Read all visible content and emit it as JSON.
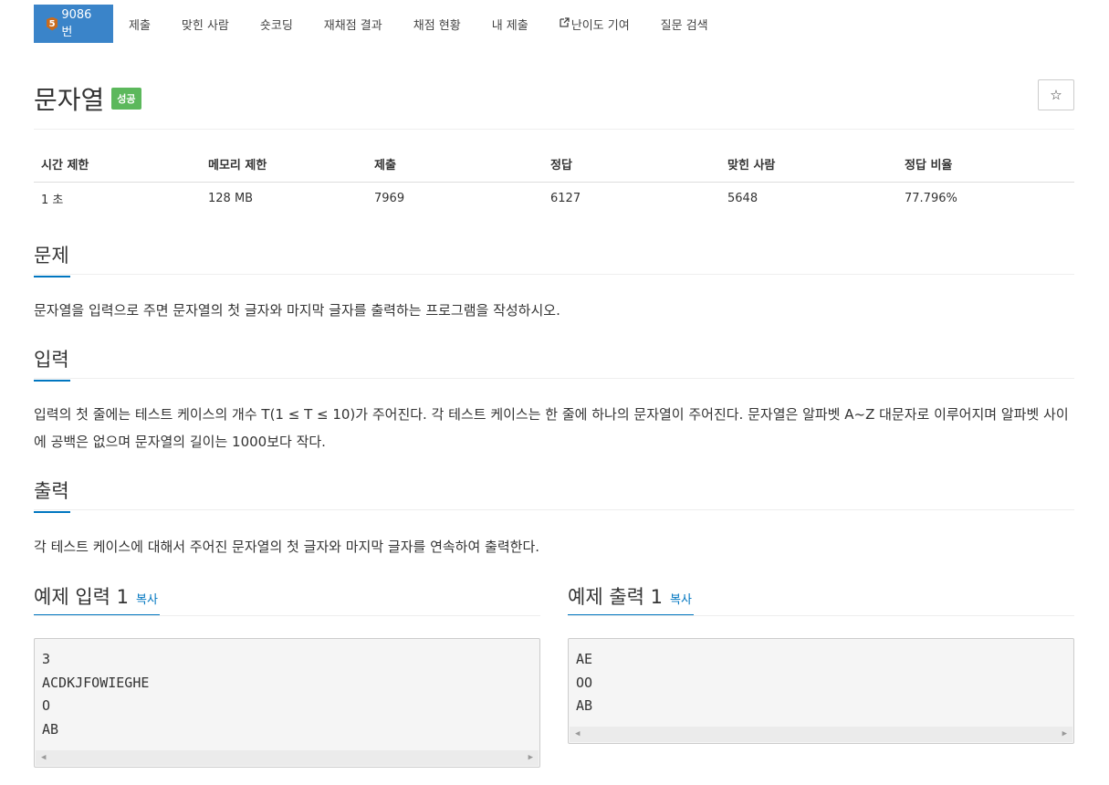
{
  "nav": {
    "tier": "5",
    "problem_number": "9086번",
    "items": [
      "제출",
      "맞힌 사람",
      "숏코딩",
      "재채점 결과",
      "채점 현황",
      "내 제출",
      "난이도 기여",
      "질문 검색"
    ]
  },
  "title": "문자열",
  "status_badge": "성공",
  "star_label": "☆",
  "info": {
    "headers": [
      "시간 제한",
      "메모리 제한",
      "제출",
      "정답",
      "맞힌 사람",
      "정답 비율"
    ],
    "values": [
      "1 초",
      "128 MB",
      "7969",
      "6127",
      "5648",
      "77.796%"
    ]
  },
  "sections": {
    "problem": {
      "heading": "문제",
      "text": "문자열을 입력으로 주면 문자열의 첫 글자와 마지막 글자를 출력하는 프로그램을 작성하시오."
    },
    "input": {
      "heading": "입력",
      "text": "입력의 첫 줄에는 테스트 케이스의 개수 T(1 ≤ T ≤ 10)가 주어진다. 각 테스트 케이스는 한 줄에 하나의 문자열이 주어진다. 문자열은 알파벳 A~Z 대문자로 이루어지며 알파벳 사이에 공백은 없으며 문자열의 길이는 1000보다 작다."
    },
    "output": {
      "heading": "출력",
      "text": "각 테스트 케이스에 대해서 주어진 문자열의 첫 글자와 마지막 글자를 연속하여 출력한다."
    }
  },
  "sample_input": {
    "heading": "예제 입력 1",
    "copy": "복사",
    "lines": [
      "3",
      "ACDKJFOWIEGHE",
      "O",
      "AB"
    ]
  },
  "sample_output": {
    "heading": "예제 출력 1",
    "copy": "복사",
    "lines": [
      "AE",
      "OO",
      "AB"
    ]
  },
  "colors": {
    "nav_active": "#3a84c9",
    "tier_badge": "#c76b1e",
    "success": "#5cb85c",
    "accent": "#0076c0"
  }
}
